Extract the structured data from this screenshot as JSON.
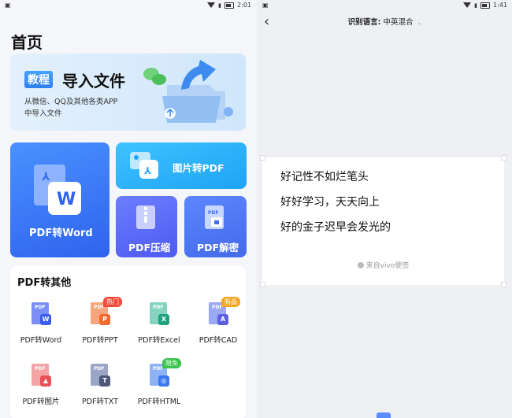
{
  "left": {
    "status": {
      "time": "2:01"
    },
    "title": "首页",
    "banner": {
      "badge": "教程",
      "title": "导入文件",
      "desc_line1": "从微信、QQ及其他各类APP",
      "desc_line2": "中导入文件"
    },
    "cards": {
      "word": "PDF转Word",
      "image": "图片转PDF",
      "compress": "PDF压缩",
      "decrypt": "PDF解密"
    },
    "section": {
      "title": "PDF转其他",
      "tools": [
        {
          "label": "PDF转Word",
          "doc_text": "PDF",
          "badge": "W",
          "color": "#7c8ff7",
          "badge_color": "#3b5cf0"
        },
        {
          "label": "PDF转PPT",
          "doc_text": "PDF",
          "badge": "P",
          "color": "#f7a57c",
          "badge_color": "#f26a2e",
          "tag": "热门",
          "tag_color": "#f24b3c"
        },
        {
          "label": "PDF转Excel",
          "doc_text": "PDF",
          "badge": "X",
          "color": "#86d3c0",
          "badge_color": "#1fa37f"
        },
        {
          "label": "PDF转CAD",
          "doc_text": "PDF",
          "badge": "A",
          "color": "#9aa8f5",
          "badge_color": "#5b5fe0",
          "tag": "新品",
          "tag_color": "#f5a623"
        },
        {
          "label": "PDF转图片",
          "doc_text": "PDF",
          "badge": "▲",
          "color": "#f4a4a4",
          "badge_color": "#e9505a"
        },
        {
          "label": "PDF转TXT",
          "doc_text": "PDF",
          "badge": "T",
          "color": "#9ba6c6",
          "badge_color": "#4d5878"
        },
        {
          "label": "PDF转HTML",
          "doc_text": "PDF",
          "badge": "◎",
          "color": "#8fb2f5",
          "badge_color": "#3b78ef",
          "tag": "限免",
          "tag_color": "#39c24d"
        }
      ]
    }
  },
  "right": {
    "status": {
      "time": "1:41"
    },
    "lang_label": "识别语言:",
    "lang_value": "中英混合",
    "note_lines": [
      "好记性不如烂笔头",
      "好好学习，天天向上",
      "好的金子迟早会发光的"
    ],
    "note_source": "来自vivo便签"
  },
  "icons": [
    "back-arrow-icon",
    "chevron-down-icon",
    "wifi-icon",
    "battery-icon",
    "signal-icon"
  ]
}
